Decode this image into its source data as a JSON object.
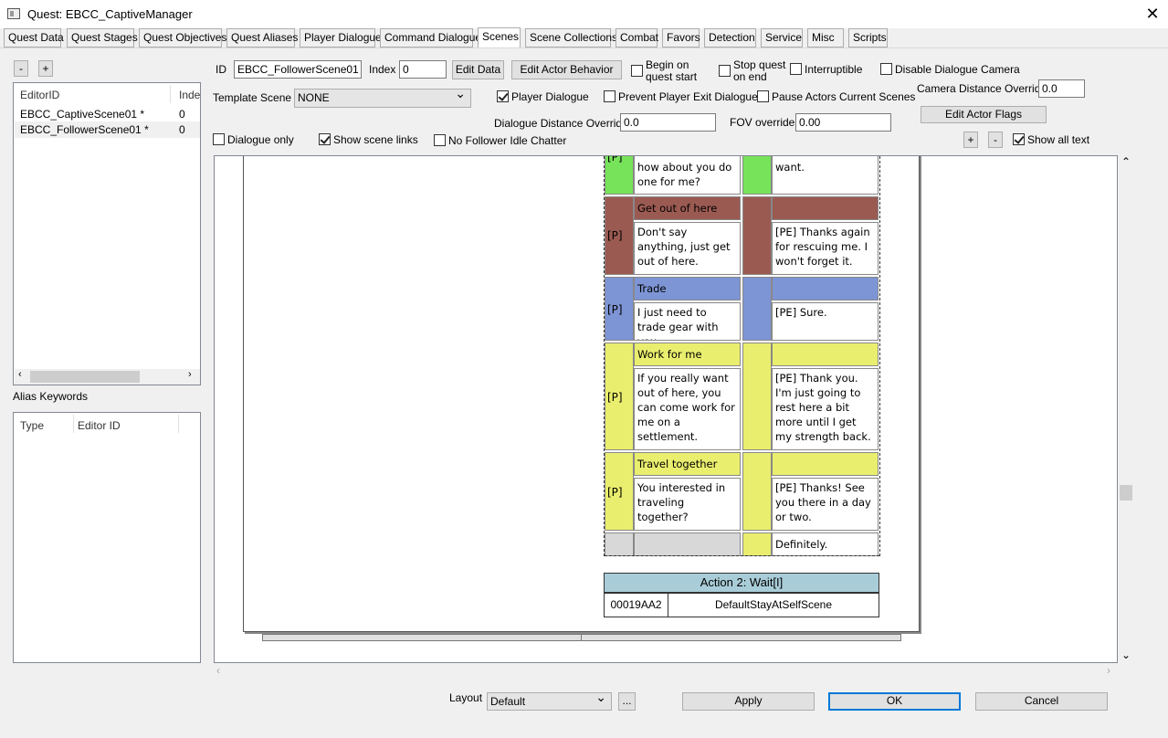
{
  "window": {
    "title": "Quest: EBCC_CaptiveManager",
    "close": "✕"
  },
  "tabs": [
    "Quest Data",
    "Quest Stages",
    "Quest Objectives",
    "Quest Aliases",
    "Player Dialogue",
    "Command Dialogue",
    "Scenes",
    "Scene Collections",
    "Combat",
    "Favors",
    "Detection",
    "Service",
    "Misc",
    "Scripts"
  ],
  "active_tab": "Scenes",
  "left": {
    "minus": "-",
    "plus": "+",
    "scene_list": {
      "headers": [
        "EditorID",
        "Inde"
      ],
      "rows": [
        {
          "id": "EBCC_CaptiveScene01 *",
          "index": "0"
        },
        {
          "id": "EBCC_FollowerScene01 *",
          "index": "0"
        }
      ]
    },
    "alias_keywords_label": "Alias Keywords",
    "alias_list": {
      "headers": [
        "Type",
        "Editor ID"
      ]
    }
  },
  "form": {
    "id_label": "ID",
    "id_value": "EBCC_FollowerScene01",
    "index_label": "Index",
    "index_value": "0",
    "edit_data": "Edit Data",
    "edit_actor_behavior": "Edit Actor Behavior",
    "begin_on_quest_start": "Begin on quest start",
    "stop_quest_on_end": "Stop quest on end",
    "interruptible": "Interruptible",
    "disable_dialogue_camera": "Disable Dialogue Camera",
    "template_scene_label": "Template Scene",
    "template_scene_value": "NONE",
    "player_dialogue": "Player Dialogue",
    "prevent_player_exit": "Prevent Player Exit Dialogue",
    "pause_actors": "Pause Actors Current Scenes",
    "camera_distance_label": "Camera Distance Override",
    "camera_distance_value": "0.0",
    "dialogue_distance_label": "Dialogue Distance Override",
    "dialogue_distance_value": "0.0",
    "fov_label": "FOV override",
    "fov_value": "0.00",
    "edit_actor_flags": "Edit Actor Flags",
    "dialogue_only": "Dialogue only",
    "show_scene_links": "Show scene links",
    "no_follower_idle": "No Follower Idle Chatter",
    "zoom_in": "+",
    "zoom_out": "-",
    "show_all_text": "Show all text"
  },
  "scene": {
    "blocks": [
      {
        "color": "#77e35a",
        "tag": "[P]",
        "title": "",
        "player": "how about you do one for me?",
        "npc": "want."
      },
      {
        "color": "#9a5a52",
        "tag": "[P]",
        "title": "Get out of here",
        "player": "Don't say anything, just get out of here.",
        "npc": "[PE] Thanks again for rescuing me. I won't forget it."
      },
      {
        "color": "#7d95d5",
        "tag": "[P]",
        "title": "Trade",
        "player": "I just need to trade gear with you.",
        "npc": "[PE] Sure."
      },
      {
        "color": "#eaee6e",
        "tag": "[P]",
        "title": "Work for me",
        "player": "If you really want out of here, you can come work for me on a settlement.",
        "npc": "[PE] Thank you. I'm just going to rest here a bit more until I get my strength back."
      },
      {
        "color": "#eaee6e",
        "tag": "[P]",
        "title": "Travel together",
        "player": "You interested in traveling together?",
        "npc": "[PE] Thanks! See you there in a day or two."
      }
    ],
    "last_npc": "Definitely.",
    "action_title": "Action 2: Wait[I]",
    "action_id": "00019AA2",
    "action_name": "DefaultStayAtSelfScene"
  },
  "bottom": {
    "layout_label": "Layout",
    "layout_value": "Default",
    "ellipsis": "...",
    "apply": "Apply",
    "ok": "OK",
    "cancel": "Cancel"
  }
}
